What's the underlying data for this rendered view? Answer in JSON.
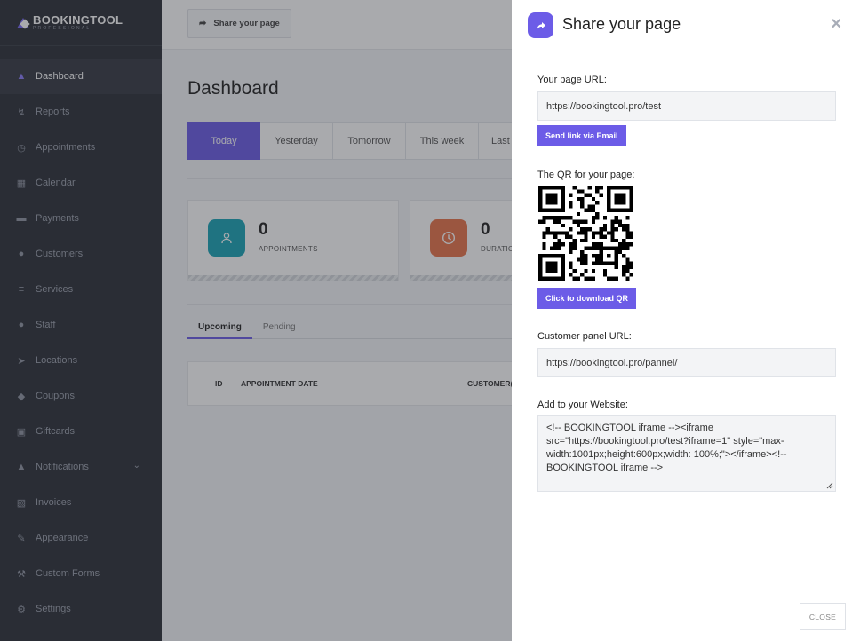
{
  "brand": {
    "name": "BOOKINGTOOL",
    "tagline": "PROFESSIONAL"
  },
  "sidebar": {
    "items": [
      {
        "label": "Dashboard",
        "icon": "cube-icon",
        "active": true
      },
      {
        "label": "Reports",
        "icon": "chart-icon"
      },
      {
        "label": "Appointments",
        "icon": "clock-icon"
      },
      {
        "label": "Calendar",
        "icon": "calendar-icon"
      },
      {
        "label": "Payments",
        "icon": "card-icon"
      },
      {
        "label": "Customers",
        "icon": "users-icon"
      },
      {
        "label": "Services",
        "icon": "list-icon"
      },
      {
        "label": "Staff",
        "icon": "user-icon"
      },
      {
        "label": "Locations",
        "icon": "location-arrow-icon"
      },
      {
        "label": "Coupons",
        "icon": "tag-icon"
      },
      {
        "label": "Giftcards",
        "icon": "gift-icon"
      },
      {
        "label": "Notifications",
        "icon": "bell-icon",
        "has_chevron": true
      },
      {
        "label": "Invoices",
        "icon": "file-icon"
      },
      {
        "label": "Appearance",
        "icon": "brush-icon"
      },
      {
        "label": "Custom Forms",
        "icon": "wrench-icon"
      },
      {
        "label": "Settings",
        "icon": "gear-icon"
      }
    ]
  },
  "topbar": {
    "share_label": "Share your page"
  },
  "dashboard": {
    "title": "Dashboard",
    "period_tabs": [
      "Today",
      "Yesterday",
      "Tomorrow",
      "This week",
      "Last"
    ],
    "active_tab": "Today",
    "stats": [
      {
        "value": "0",
        "label": "APPOINTMENTS",
        "color": "#1aa3b6"
      },
      {
        "value": "0",
        "label": "DURATIO",
        "color": "#e8734a"
      }
    ],
    "sub_tabs": [
      "Upcoming",
      "Pending"
    ],
    "table_headers": [
      "ID",
      "APPOINTMENT DATE",
      "CUSTOMER("
    ]
  },
  "drawer": {
    "title": "Share your page",
    "page_url_label": "Your page URL:",
    "page_url": "https://bookingtool.pro/test",
    "send_email_label": "Send link via Email",
    "qr_label": "The QR for your page:",
    "download_qr_label": "Click to download QR",
    "customer_panel_label": "Customer panel URL:",
    "customer_panel_url": "https://bookingtool.pro/pannel/",
    "website_label": "Add to your Website:",
    "embed_code": "<!-- BOOKINGTOOL iframe --><iframe src=\"https://bookingtool.pro/test?iframe=1\" style=\"max-width:1001px;height:600px;width: 100%;\"></iframe><!-- BOOKINGTOOL iframe -->",
    "close_label": "CLOSE"
  },
  "colors": {
    "accent": "#6c5ce7",
    "sidebar": "#2c2f37",
    "teal": "#1aa3b6",
    "orange": "#e8734a"
  }
}
